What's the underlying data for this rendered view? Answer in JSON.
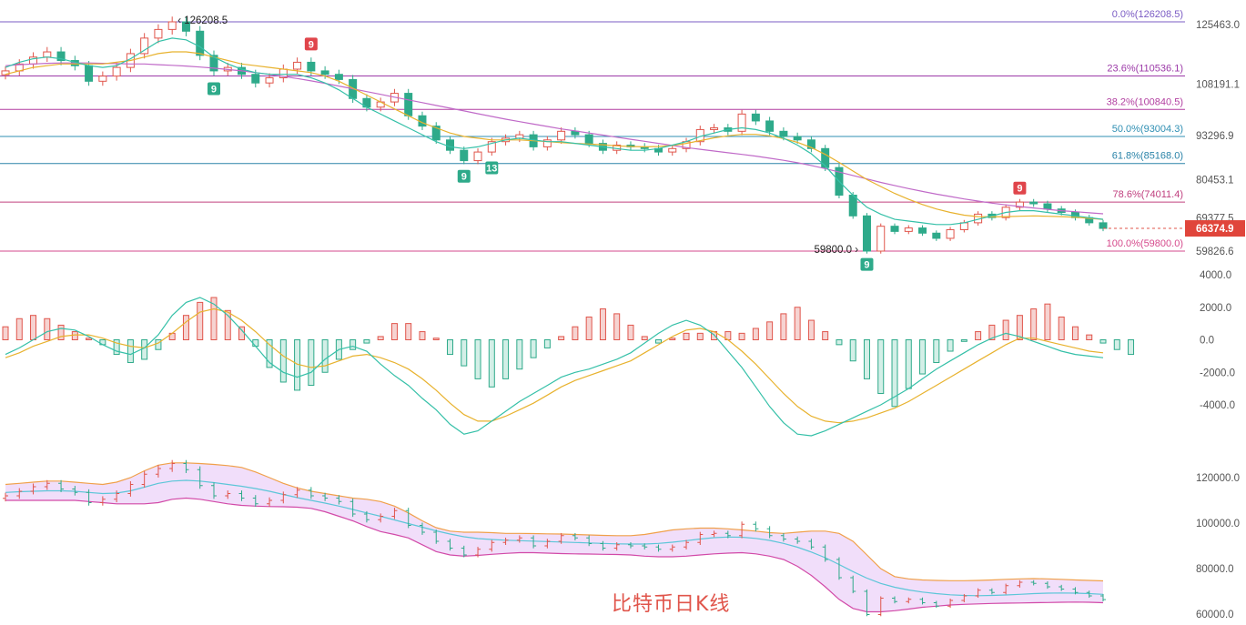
{
  "chart_data": [
    {
      "type": "candlestick",
      "panel": "price",
      "current_price_label": "66374.9",
      "y_axis_ticks": [
        "125463.0",
        "108191.1",
        "93296.9",
        "80453.1",
        "69377.5",
        "59826.6"
      ],
      "annotations": {
        "high_label": "126208.5",
        "low_label": "59800.0",
        "td_markers": [
          "9",
          "9",
          "9",
          "13",
          "9",
          "9"
        ]
      },
      "fibonacci_levels": [
        {
          "label": "0.0%(126208.5)",
          "value": 126208.5,
          "color": "#7b5cc4"
        },
        {
          "label": "23.6%(110536.1)",
          "value": 110536.1,
          "color": "#9c3aa8"
        },
        {
          "label": "38.2%(100840.5)",
          "value": 100840.5,
          "color": "#b23fa0"
        },
        {
          "label": "50.0%(93004.3)",
          "value": 93004.3,
          "color": "#2f8fb3"
        },
        {
          "label": "61.8%(85168.0)",
          "value": 85168.0,
          "color": "#2a83a8"
        },
        {
          "label": "78.6%(74011.4)",
          "value": 74011.4,
          "color": "#c0407f"
        },
        {
          "label": "100.0%(59800.0)",
          "value": 59800.0,
          "color": "#d64a8c"
        }
      ],
      "close_path": [
        112000,
        114000,
        116000,
        117500,
        115000,
        113500,
        109000,
        110500,
        113000,
        117000,
        121500,
        124000,
        126208.5,
        123500,
        116500,
        112000,
        113000,
        111000,
        108500,
        110000,
        112500,
        114500,
        112000,
        111000,
        109500,
        104000,
        101500,
        103000,
        105500,
        99000,
        96000,
        92000,
        89000,
        86000,
        88500,
        91500,
        92500,
        93500,
        90000,
        92000,
        94500,
        93500,
        91000,
        89000,
        90500,
        90000,
        89500,
        88500,
        89500,
        91500,
        95000,
        95500,
        94500,
        99500,
        97500,
        94500,
        93000,
        92000,
        89500,
        84000,
        76000,
        70000,
        59800,
        67000,
        65500,
        66500,
        65000,
        63500,
        66000,
        68000,
        70500,
        69500,
        72500,
        74000,
        73500,
        72000,
        71000,
        69500,
        68000,
        66374.9
      ],
      "ma_fast": [
        113000,
        114500,
        115500,
        116000,
        115500,
        114500,
        113500,
        113000,
        113500,
        115500,
        118000,
        120500,
        121500,
        121000,
        119000,
        116000,
        114000,
        112500,
        111500,
        111000,
        111000,
        111000,
        110000,
        108500,
        106500,
        104000,
        101500,
        99500,
        97500,
        95500,
        93500,
        91500,
        90000,
        89500,
        90000,
        91000,
        92000,
        92500,
        92000,
        91500,
        91500,
        91000,
        90500,
        90000,
        89500,
        89000,
        89000,
        89500,
        90500,
        91500,
        93000,
        94000,
        95000,
        95500,
        95000,
        94000,
        92500,
        90500,
        88000,
        84500,
        80000,
        76000,
        72500,
        70500,
        69000,
        68500,
        68000,
        67500,
        67500,
        68000,
        69000,
        70000,
        71000,
        71500,
        71500,
        71000,
        70500,
        70000,
        69500,
        69000
      ],
      "ma_slow": [
        111000,
        112000,
        113000,
        113500,
        114000,
        114000,
        114000,
        114000,
        114500,
        115000,
        116000,
        117000,
        117500,
        117500,
        117000,
        116000,
        115000,
        114000,
        113500,
        113000,
        112500,
        112000,
        111500,
        110500,
        109000,
        107000,
        105000,
        103000,
        101000,
        99000,
        97000,
        95500,
        94000,
        93000,
        92500,
        92000,
        92000,
        92000,
        91800,
        91500,
        91200,
        91000,
        90800,
        90600,
        90300,
        90100,
        90000,
        90100,
        90400,
        91000,
        91800,
        92600,
        93200,
        93600,
        93600,
        93200,
        92400,
        91300,
        89800,
        87800,
        85500,
        83000,
        80500,
        78500,
        76500,
        74800,
        73300,
        72000,
        71000,
        70200,
        69800,
        69700,
        69800,
        69900,
        70000,
        69900,
        69800,
        69600,
        69300,
        69000
      ],
      "ma_long": [
        113500,
        113800,
        114000,
        114200,
        114300,
        114300,
        114300,
        114200,
        114100,
        114000,
        114000,
        113800,
        113600,
        113400,
        113100,
        112800,
        112400,
        112000,
        111500,
        111000,
        110400,
        109800,
        109100,
        108400,
        107600,
        106800,
        106000,
        105200,
        104400,
        103600,
        102800,
        102000,
        101200,
        100400,
        99600,
        98800,
        98000,
        97300,
        96600,
        95900,
        95200,
        94600,
        94000,
        93400,
        92800,
        92200,
        91600,
        91000,
        90400,
        89800,
        89300,
        88800,
        88300,
        87800,
        87300,
        86700,
        86100,
        85400,
        84600,
        83700,
        82700,
        81700,
        80700,
        79700,
        78800,
        77900,
        77100,
        76300,
        75600,
        74900,
        74300,
        73700,
        73200,
        72700,
        72300,
        71900,
        71500,
        71200,
        70900,
        70600
      ]
    },
    {
      "type": "bar",
      "panel": "macd",
      "y_axis_ticks": [
        "4000.0",
        "2000.0",
        "0.0",
        "-2000.0",
        "-4000.0"
      ],
      "histogram": [
        800,
        1300,
        1500,
        1300,
        900,
        500,
        100,
        -300,
        -900,
        -1400,
        -1200,
        -600,
        400,
        1500,
        2300,
        2600,
        1800,
        800,
        -400,
        -1700,
        -2600,
        -3100,
        -2800,
        -2000,
        -1200,
        -600,
        -200,
        200,
        1000,
        1000,
        500,
        100,
        -900,
        -1600,
        -2400,
        -2900,
        -2400,
        -1800,
        -1100,
        -500,
        200,
        800,
        1400,
        1900,
        1600,
        900,
        200,
        -200,
        100,
        400,
        400,
        500,
        500,
        400,
        700,
        1100,
        1600,
        2000,
        1200,
        500,
        -300,
        -1300,
        -2400,
        -3300,
        -4100,
        -3000,
        -2100,
        -1400,
        -700,
        -100,
        500,
        900,
        1200,
        1500,
        1900,
        2200,
        1400,
        800,
        300,
        -200,
        -600,
        -900
      ],
      "dif": [
        -900,
        -500,
        0,
        500,
        700,
        600,
        200,
        -300,
        -700,
        -900,
        -500,
        300,
        1500,
        2300,
        2600,
        2200,
        1500,
        600,
        -400,
        -1400,
        -2000,
        -2300,
        -2000,
        -1200,
        -600,
        -400,
        -700,
        -1500,
        -2200,
        -2800,
        -3600,
        -4300,
        -5200,
        -5800,
        -5600,
        -5000,
        -4400,
        -3800,
        -3300,
        -2800,
        -2300,
        -2000,
        -1800,
        -1500,
        -1200,
        -800,
        -200,
        400,
        900,
        1200,
        900,
        300,
        -700,
        -1700,
        -2900,
        -4100,
        -5100,
        -5800,
        -5900,
        -5600,
        -5200,
        -4800,
        -4400,
        -4000,
        -3500,
        -3000,
        -2400,
        -1800,
        -1300,
        -800,
        -300,
        100,
        400,
        200,
        -100,
        -400,
        -700,
        -900,
        -1000,
        -1100
      ],
      "dea": [
        -1100,
        -800,
        -400,
        -100,
        200,
        300,
        300,
        100,
        -200,
        -400,
        -500,
        -200,
        400,
        1100,
        1700,
        1900,
        1700,
        1200,
        500,
        -300,
        -1000,
        -1500,
        -1700,
        -1600,
        -1300,
        -1000,
        -900,
        -1100,
        -1400,
        -1800,
        -2400,
        -3100,
        -3900,
        -4600,
        -5000,
        -5000,
        -4700,
        -4300,
        -3900,
        -3400,
        -2900,
        -2500,
        -2200,
        -1900,
        -1600,
        -1300,
        -800,
        -300,
        200,
        600,
        700,
        500,
        0,
        -700,
        -1500,
        -2400,
        -3300,
        -4100,
        -4700,
        -5000,
        -5100,
        -5000,
        -4800,
        -4500,
        -4200,
        -3800,
        -3300,
        -2800,
        -2300,
        -1800,
        -1300,
        -800,
        -300,
        100,
        100,
        -100,
        -300,
        -500,
        -700,
        -800
      ]
    },
    {
      "type": "line",
      "panel": "bollinger",
      "y_axis_ticks": [
        "120000.0",
        "100000.0",
        "80000.0",
        "60000.0"
      ],
      "upper": [
        117000,
        117500,
        118000,
        118500,
        118500,
        118000,
        117500,
        117000,
        118000,
        120000,
        123000,
        125500,
        126500,
        126500,
        126200,
        125800,
        125300,
        124500,
        122500,
        120000,
        117500,
        115500,
        114000,
        113000,
        112000,
        111000,
        110500,
        109500,
        107500,
        104500,
        101000,
        98000,
        96500,
        96000,
        96000,
        95800,
        95500,
        95500,
        95400,
        95300,
        95200,
        95000,
        94800,
        94600,
        94500,
        94500,
        95000,
        96000,
        97000,
        97500,
        97800,
        97800,
        97500,
        97000,
        96500,
        95800,
        95500,
        96000,
        96500,
        96500,
        95500,
        92000,
        86000,
        80000,
        76500,
        75500,
        75000,
        74800,
        74700,
        74700,
        74800,
        75000,
        75300,
        75500,
        75600,
        75500,
        75300,
        75000,
        74800,
        74600
      ],
      "middle": [
        113500,
        113800,
        114000,
        114200,
        114200,
        114000,
        113500,
        113000,
        113200,
        114200,
        115800,
        117500,
        118500,
        118800,
        118500,
        117800,
        117000,
        116200,
        115200,
        114000,
        112600,
        111200,
        110000,
        108800,
        107500,
        106000,
        104500,
        103000,
        101400,
        99800,
        98200,
        96600,
        95200,
        94000,
        93200,
        92800,
        92500,
        92300,
        92100,
        91900,
        91700,
        91500,
        91300,
        91100,
        90900,
        90800,
        90800,
        91100,
        91600,
        92300,
        93000,
        93600,
        93900,
        93800,
        93300,
        92400,
        91100,
        89400,
        87300,
        84800,
        81800,
        78700,
        75800,
        73500,
        71800,
        70600,
        69700,
        69000,
        68500,
        68200,
        68100,
        68200,
        68400,
        68700,
        69000,
        69200,
        69300,
        69200,
        69000,
        68700
      ],
      "lower": [
        110000,
        110000,
        110000,
        110000,
        110000,
        110000,
        109500,
        109000,
        108500,
        108500,
        108500,
        109000,
        110500,
        111000,
        110500,
        109500,
        108500,
        107800,
        107500,
        107300,
        107200,
        107000,
        106500,
        105000,
        103000,
        101000,
        98500,
        96300,
        95000,
        93500,
        90500,
        87500,
        86000,
        85500,
        85800,
        86300,
        86700,
        87000,
        87000,
        86800,
        86600,
        86500,
        86400,
        86300,
        86200,
        86000,
        85500,
        85200,
        85200,
        85500,
        86000,
        86500,
        86800,
        87000,
        86500,
        85500,
        84000,
        81000,
        77000,
        72000,
        66500,
        62500,
        61000,
        61000,
        61500,
        62200,
        63000,
        63500,
        64000,
        64300,
        64500,
        64700,
        64800,
        64900,
        65000,
        65100,
        65200,
        65300,
        65200,
        65000
      ]
    }
  ],
  "caption": "比特币日K线"
}
